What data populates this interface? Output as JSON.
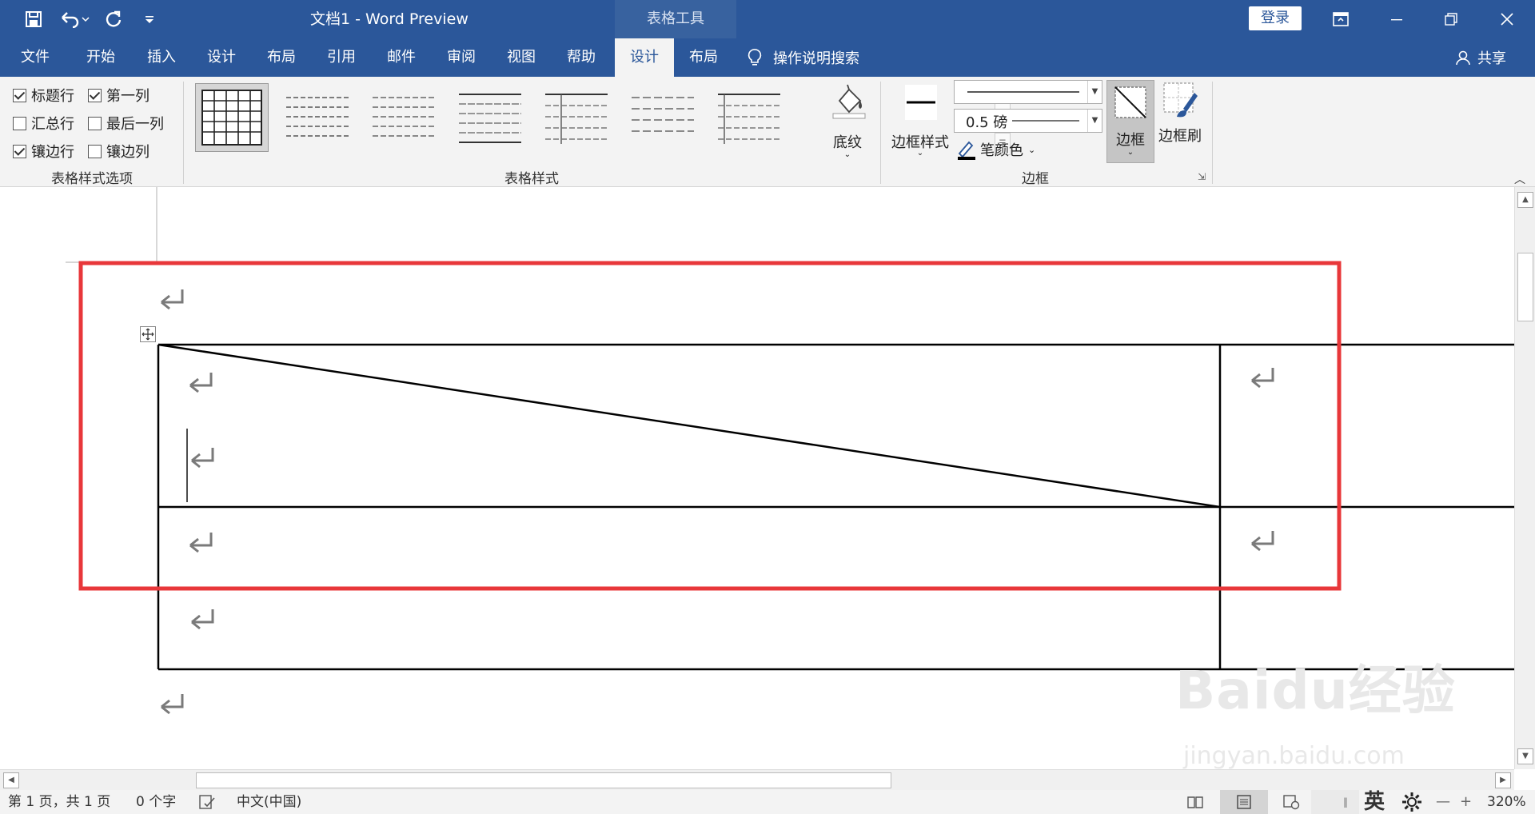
{
  "titlebar": {
    "doc_title": "文档1  -  Word Preview",
    "context_tab": "表格工具",
    "login": "登录"
  },
  "tabs": [
    {
      "label": "文件"
    },
    {
      "label": "开始"
    },
    {
      "label": "插入"
    },
    {
      "label": "设计"
    },
    {
      "label": "布局"
    },
    {
      "label": "引用"
    },
    {
      "label": "邮件"
    },
    {
      "label": "审阅"
    },
    {
      "label": "视图"
    },
    {
      "label": "帮助"
    },
    {
      "label": "设计"
    },
    {
      "label": "布局"
    }
  ],
  "tell_me": "操作说明搜索",
  "share": "共享",
  "style_options": {
    "group_label": "表格样式选项",
    "items": [
      {
        "label": "标题行",
        "checked": true
      },
      {
        "label": "第一列",
        "checked": true
      },
      {
        "label": "汇总行",
        "checked": false
      },
      {
        "label": "最后一列",
        "checked": false
      },
      {
        "label": "镶边行",
        "checked": true
      },
      {
        "label": "镶边列",
        "checked": false
      }
    ]
  },
  "table_styles": {
    "group_label": "表格样式",
    "shading": "底纹"
  },
  "borders": {
    "group_label": "边框",
    "border_styles": "边框样式",
    "weight": "0.5 磅",
    "pen_color": "笔颜色",
    "borders_btn": "边框",
    "painter": "边框刷"
  },
  "statusbar": {
    "page": "第 1 页，共 1 页",
    "words": "0 个字",
    "language": "中文(中国)",
    "ime": "英",
    "zoom": "320%"
  },
  "watermark": {
    "brand": "Baidu经验",
    "url": "jingyan.baidu.com"
  },
  "colors": {
    "accent": "#2b579a",
    "highlight_box": "#e8373a"
  }
}
